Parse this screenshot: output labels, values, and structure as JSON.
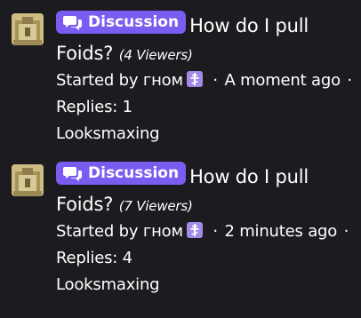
{
  "threads": [
    {
      "badge_label": "Discussion",
      "title_line1": "How do I pull",
      "title_line2": "Foids?",
      "viewers": "(4 Viewers)",
      "started_by_prefix": "Started by",
      "author": "гном",
      "author_badge_icon": "orthodox-cross-icon",
      "separator": "·",
      "time_ago": "A moment ago",
      "replies": "Replies: 1",
      "category": "Looksmaxing"
    },
    {
      "badge_label": "Discussion",
      "title_line1": "How do I pull",
      "title_line2": "Foids?",
      "viewers": "(7 Viewers)",
      "started_by_prefix": "Started by",
      "author": "гном",
      "author_badge_icon": "orthodox-cross-icon",
      "separator": "·",
      "time_ago": "2 minutes ago",
      "replies": "Replies: 4",
      "category": "Looksmaxing"
    }
  ],
  "colors": {
    "background": "#1c1b1f",
    "badge": "#7a5cf0",
    "author_badge": "#a28be8",
    "text": "#ffffff"
  }
}
